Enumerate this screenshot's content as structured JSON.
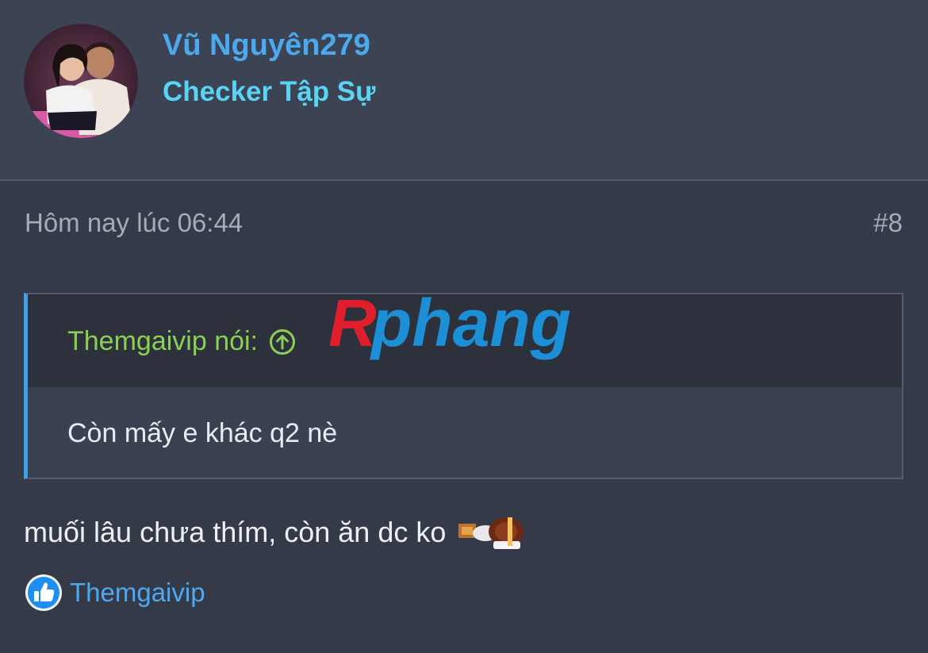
{
  "author": {
    "username": "Vũ Nguyên279",
    "title": "Checker Tập Sự"
  },
  "post": {
    "time": "Hôm nay lúc 06:44",
    "number": "#8",
    "quote": {
      "author_label": "Themgaivip nói:",
      "text": "Còn mấy e khác q2 nè"
    },
    "message": "muối lâu chưa thím, còn ăn dc ko",
    "watermark": "Rphang",
    "reactions": {
      "icon": "thumbs-up-icon",
      "users": "Themgaivip"
    }
  },
  "colors": {
    "username": "#4da9ef",
    "user_title": "#5ad3f4",
    "quote_author": "#8bcf55",
    "quote_bar": "#3f9fe9"
  }
}
